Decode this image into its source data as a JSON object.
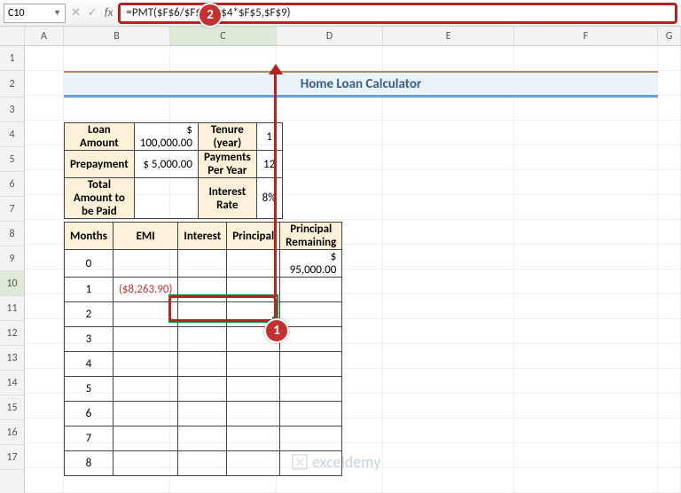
{
  "namebox": "C10",
  "formula": "=PMT($F$6/$F$5,$F$4*$F$5,$F$9)",
  "fx": "fx",
  "columns": [
    "",
    "A",
    "B",
    "C",
    "D",
    "E",
    "F",
    "G"
  ],
  "rows": [
    "1",
    "2",
    "3",
    "4",
    "5",
    "6",
    "7",
    "8",
    "9",
    "10",
    "11",
    "12",
    "13",
    "14",
    "15",
    "16",
    "17"
  ],
  "title": "Home Loan Calculator",
  "inputs": {
    "loan_amount_label": "Loan Amount",
    "loan_amount_value": "$   100,000.00",
    "tenure_label": "Tenure (year)",
    "tenure_value": "1",
    "prepayment_label": "Prepayment",
    "prepayment_value": "$       5,000.00",
    "ppy_label": "Payments Per Year",
    "ppy_value": "12",
    "total_label": "Total Amount to be Paid",
    "total_value": "",
    "rate_label": "Interest Rate",
    "rate_value": "8%"
  },
  "schedule_headers": [
    "Months",
    "EMI",
    "Interest",
    "Principal",
    "Principal Remaining"
  ],
  "schedule": [
    {
      "m": "0",
      "emi": "",
      "interest": "",
      "principal": "",
      "remain": "$              95,000.00"
    },
    {
      "m": "1",
      "emi": "($8,263.90)",
      "interest": "",
      "principal": "",
      "remain": ""
    },
    {
      "m": "2",
      "emi": "",
      "interest": "",
      "principal": "",
      "remain": ""
    },
    {
      "m": "3",
      "emi": "",
      "interest": "",
      "principal": "",
      "remain": ""
    },
    {
      "m": "4",
      "emi": "",
      "interest": "",
      "principal": "",
      "remain": ""
    },
    {
      "m": "5",
      "emi": "",
      "interest": "",
      "principal": "",
      "remain": ""
    },
    {
      "m": "6",
      "emi": "",
      "interest": "",
      "principal": "",
      "remain": ""
    },
    {
      "m": "7",
      "emi": "",
      "interest": "",
      "principal": "",
      "remain": ""
    },
    {
      "m": "8",
      "emi": "",
      "interest": "",
      "principal": "",
      "remain": ""
    }
  ],
  "callouts": {
    "one": "1",
    "two": "2"
  },
  "watermark": "exceldemy"
}
